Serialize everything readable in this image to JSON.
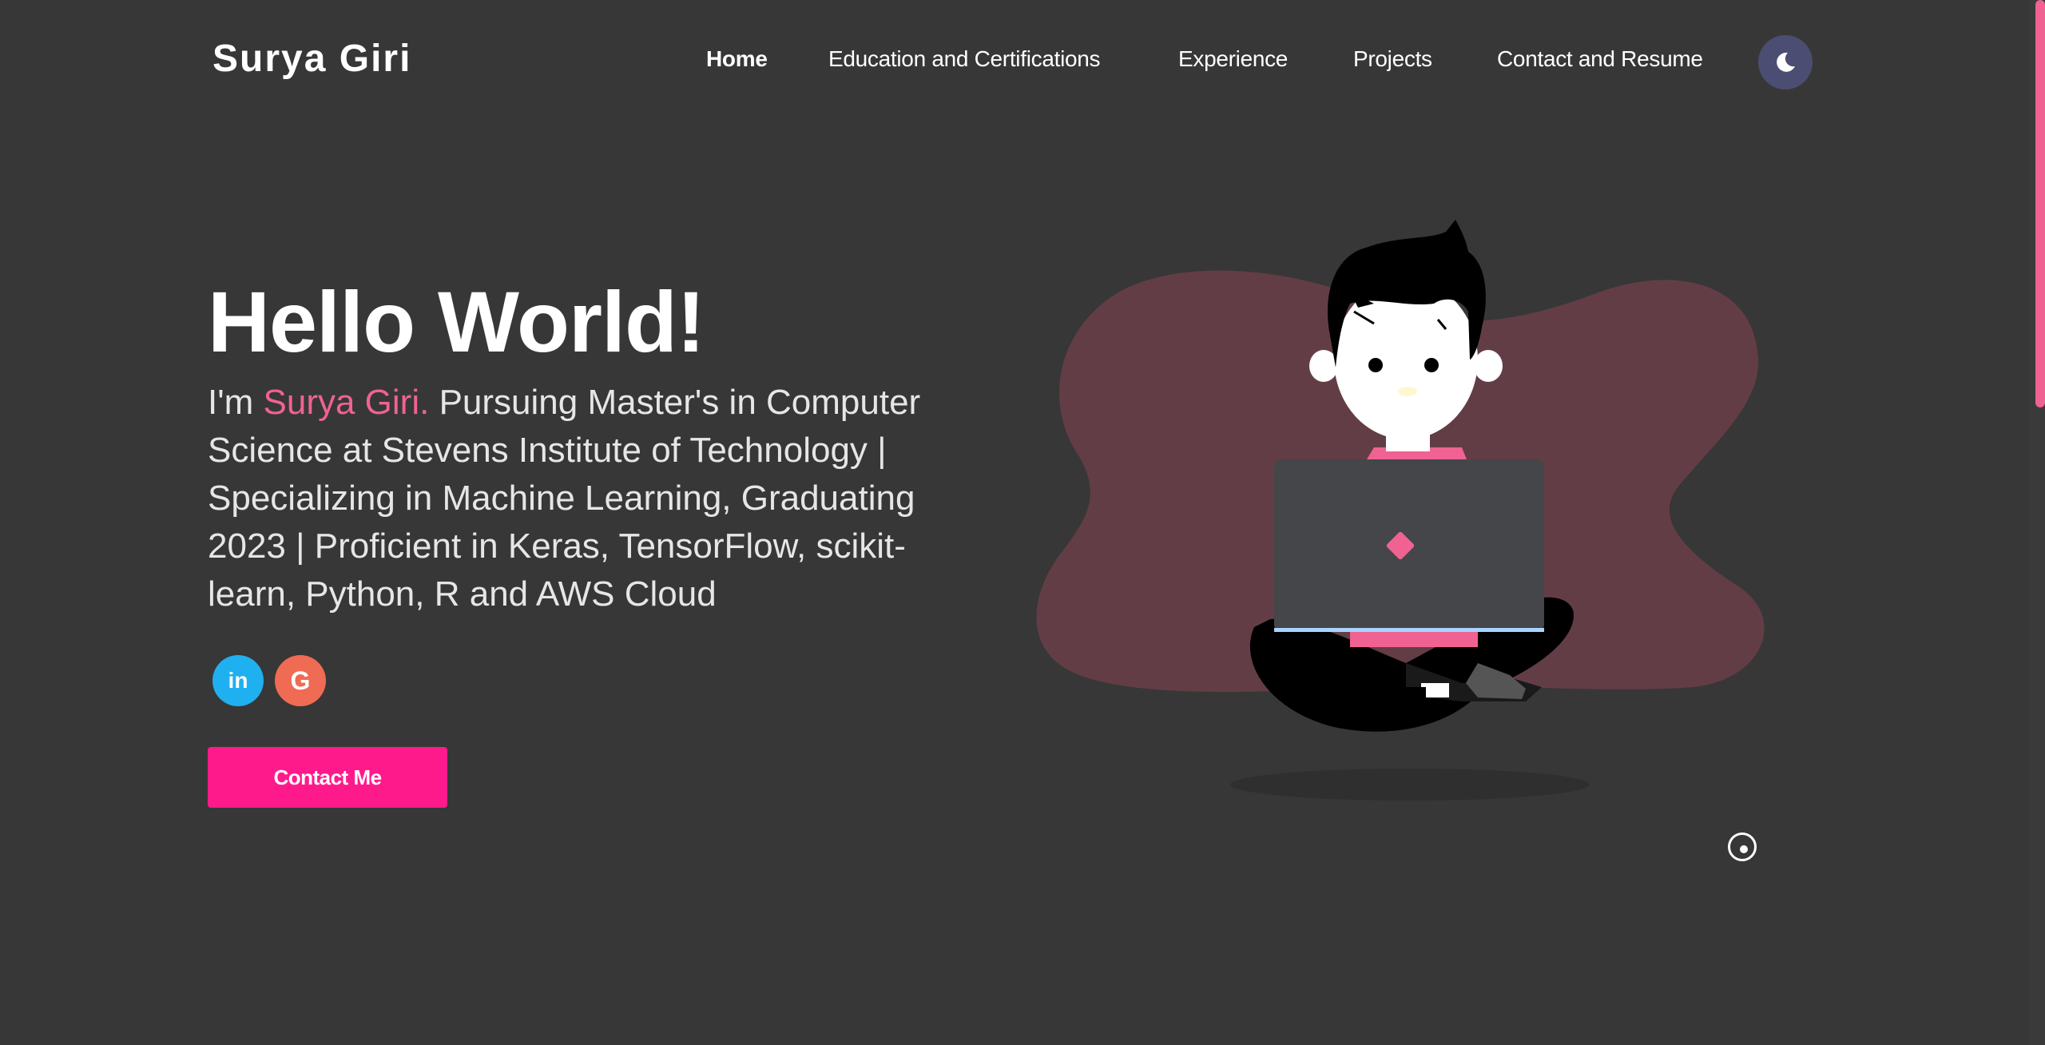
{
  "site": {
    "logo_text": "Surya Giri"
  },
  "nav": {
    "items": [
      {
        "label": "Home",
        "active": true
      },
      {
        "label": "Education and Certifications",
        "active": false
      },
      {
        "label": "Experience",
        "active": false
      },
      {
        "label": "Projects",
        "active": false
      },
      {
        "label": "Contact and Resume",
        "active": false
      }
    ],
    "theme_toggle_icon": "moon-icon"
  },
  "hero": {
    "title": "Hello World!",
    "intro_prefix": "I'm ",
    "name": "Surya Giri.",
    "description": " Pursuing Master's in Computer Science at Stevens Institute of Technology | Specializing in Machine Learning, Graduating 2023 | Proficient in Keras, TensorFlow, scikit-learn, Python, R and AWS Cloud",
    "social": [
      {
        "icon": "linkedin-icon",
        "glyph": "in"
      },
      {
        "icon": "google-icon",
        "glyph": "G"
      }
    ],
    "contact_button": "Contact Me"
  },
  "colors": {
    "background": "#373737",
    "accent": "#ff1a8c",
    "name_highlight": "#f06292",
    "linkedin": "#1fb0f0",
    "google": "#f06b54",
    "theme_toggle": "#4c4d72"
  }
}
